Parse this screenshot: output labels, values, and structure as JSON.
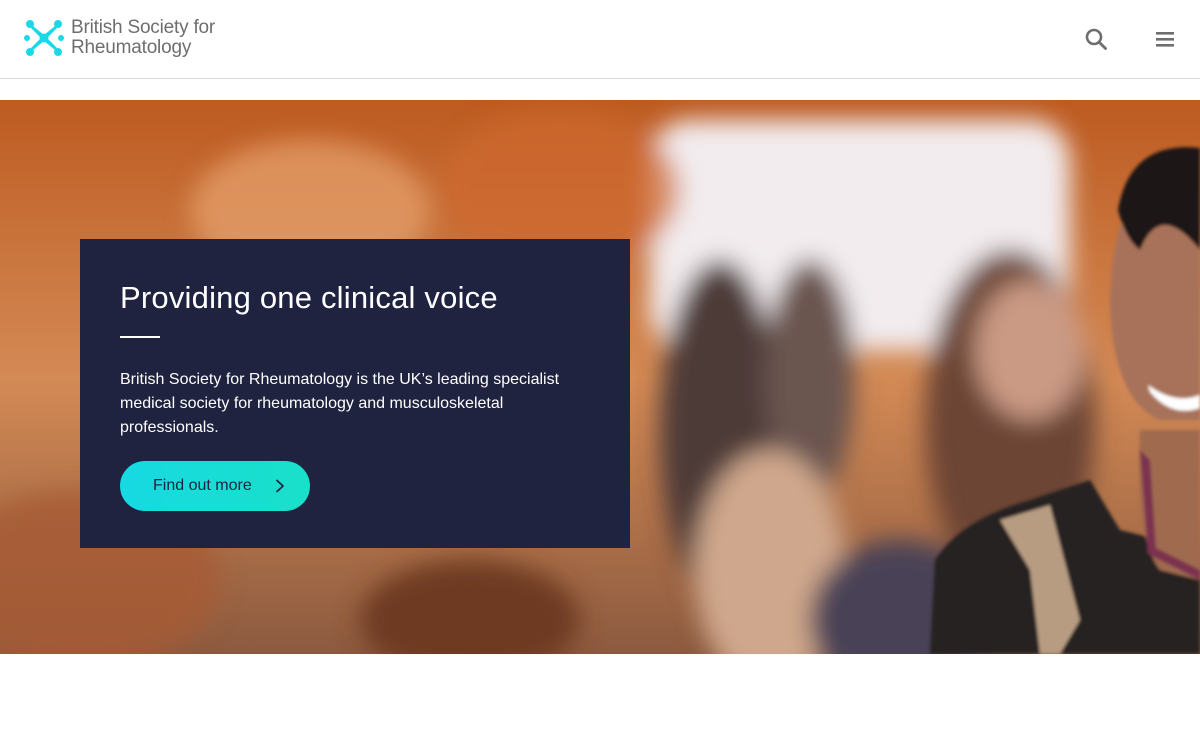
{
  "header": {
    "logo": {
      "line1": "British Society for",
      "line2": "Rheumatology"
    },
    "icons": {
      "search": "search-icon",
      "menu": "hamburger-menu-icon"
    }
  },
  "hero": {
    "title": "Providing one clinical voice",
    "description": "British Society for Rheumatology is the UK’s leading specialist medical society for rheumatology and musculoskeletal professionals.",
    "cta_label": "Find out more",
    "cta_icon": "chevron-right-icon"
  },
  "colors": {
    "brand_teal": "#1ad8e6",
    "card_navy": "#1f2340",
    "logo_grey": "#6e6e6e"
  }
}
